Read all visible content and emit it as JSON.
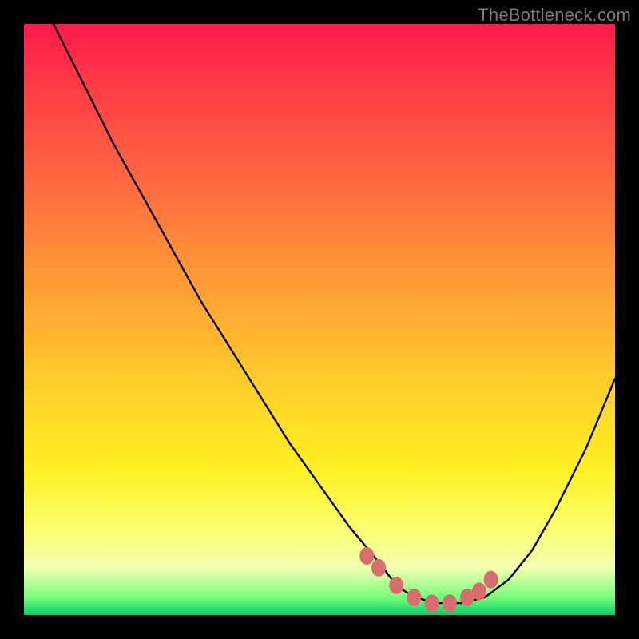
{
  "watermark": "TheBottleneck.com",
  "chart_data": {
    "type": "line",
    "title": "",
    "xlabel": "",
    "ylabel": "",
    "xlim": [
      0,
      100
    ],
    "ylim": [
      0,
      100
    ],
    "series": [
      {
        "name": "bottleneck-curve",
        "x": [
          5,
          10,
          15,
          20,
          25,
          30,
          35,
          40,
          45,
          50,
          55,
          60,
          63,
          66,
          70,
          74,
          78,
          82,
          86,
          90,
          95,
          100
        ],
        "values": [
          100,
          90,
          80,
          71,
          62,
          53,
          45,
          37,
          29,
          22,
          15,
          9,
          5,
          3,
          2,
          2,
          3,
          6,
          11,
          18,
          28,
          40
        ]
      }
    ],
    "markers": {
      "name": "highlight-dots",
      "color": "#d96c6c",
      "x": [
        58,
        60,
        63,
        66,
        69,
        72,
        75,
        77,
        79
      ],
      "values": [
        10,
        8,
        5,
        3,
        2,
        2,
        3,
        4,
        6
      ]
    }
  }
}
